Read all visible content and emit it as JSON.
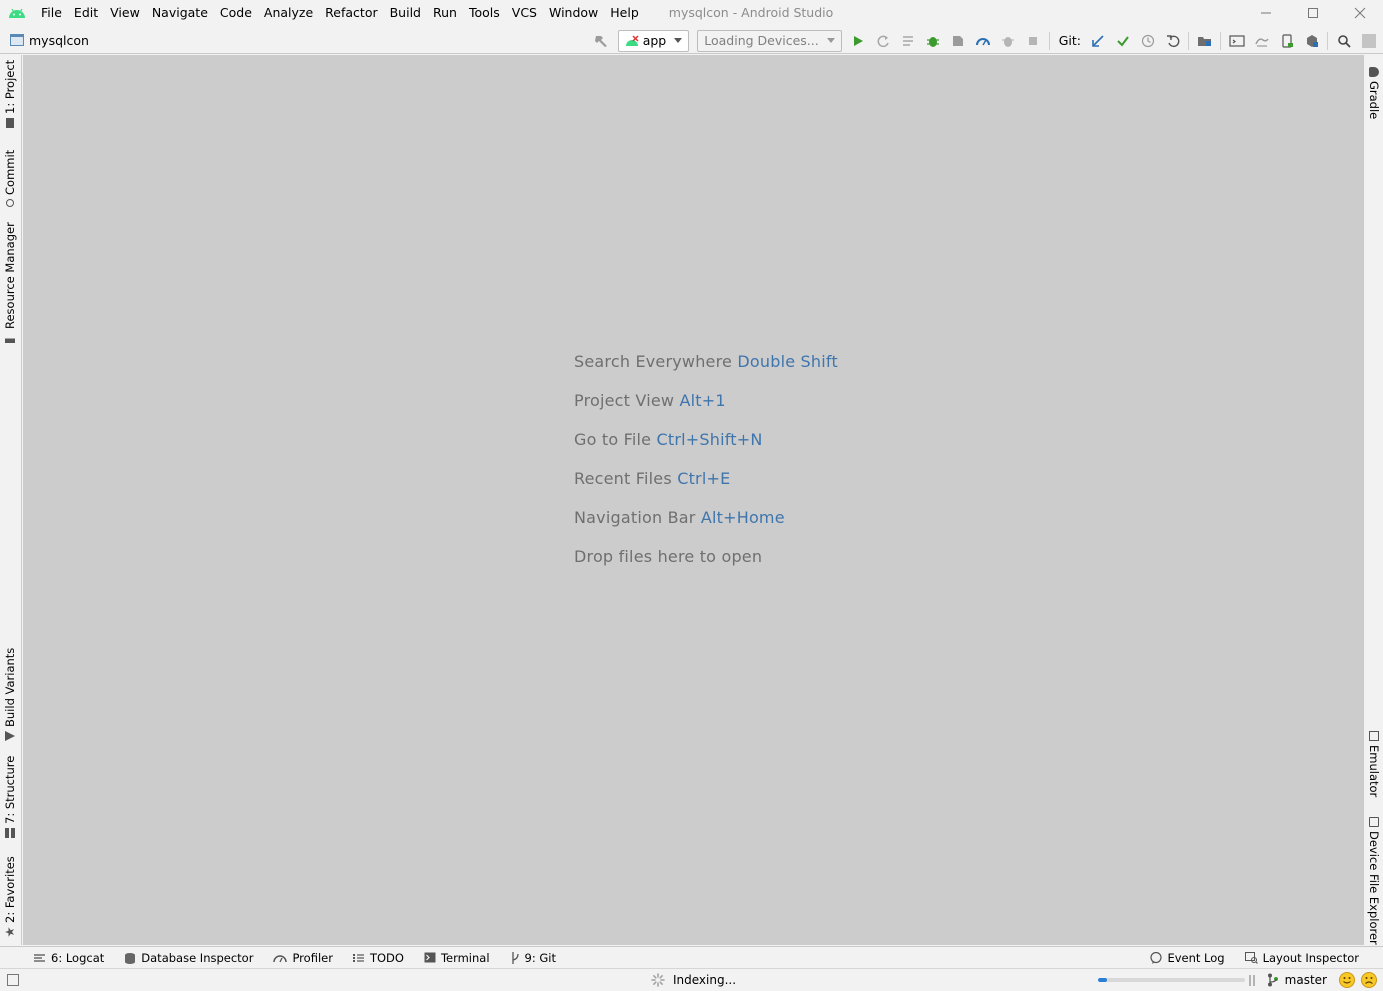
{
  "app": {
    "logo": "android-studio-icon",
    "window_title": "mysqlcon - Android Studio"
  },
  "menu": [
    "File",
    "Edit",
    "View",
    "Navigate",
    "Code",
    "Analyze",
    "Refactor",
    "Build",
    "Run",
    "Tools",
    "VCS",
    "Window",
    "Help"
  ],
  "navbar": {
    "project": "mysqlcon"
  },
  "toolbar": {
    "run_config": "app",
    "device_selector": "Loading Devices...",
    "git_label": "Git:"
  },
  "left_tabs": [
    "1: Project",
    "Commit",
    "Resource Manager",
    "Build Variants",
    "7: Structure",
    "2: Favorites"
  ],
  "right_tabs": [
    "Gradle",
    "Emulator",
    "Device File Explorer"
  ],
  "empty_editor_hints": [
    {
      "label": "Search Everywhere",
      "shortcut": "Double Shift"
    },
    {
      "label": "Project View",
      "shortcut": "Alt+1"
    },
    {
      "label": "Go to File",
      "shortcut": "Ctrl+Shift+N"
    },
    {
      "label": "Recent Files",
      "shortcut": "Ctrl+E"
    },
    {
      "label": "Navigation Bar",
      "shortcut": "Alt+Home"
    },
    {
      "label": "Drop files here to open",
      "shortcut": ""
    }
  ],
  "bottom_tabs": [
    "6: Logcat",
    "Database Inspector",
    "Profiler",
    "TODO",
    "Terminal",
    "9: Git"
  ],
  "bottom_right_tabs": [
    "Event Log",
    "Layout Inspector"
  ],
  "status": {
    "task": "Indexing...",
    "progress": 0.06,
    "branch": "master"
  },
  "colors": {
    "accent": "#3f75ad",
    "editor_bg": "#cccccc",
    "run_green": "#3c9a2f"
  }
}
